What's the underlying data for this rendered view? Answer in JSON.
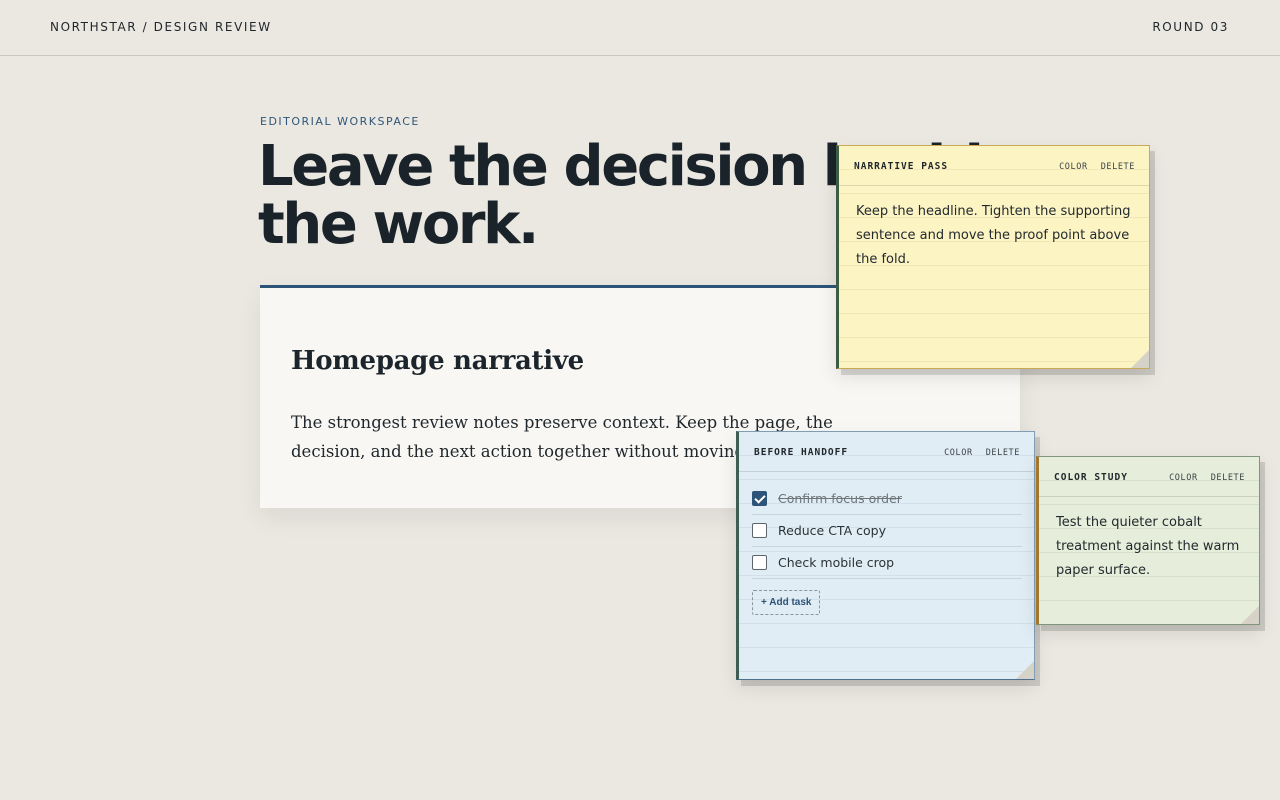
{
  "header": {
    "brand": "NORTHSTAR / DESIGN REVIEW",
    "round": "ROUND 03"
  },
  "hero": {
    "eyebrow": "EDITORIAL WORKSPACE",
    "headline": "Leave the decision beside the work."
  },
  "card": {
    "title": "Homepage narrative",
    "body": "The strongest review notes preserve context. Keep the page, the decision, and the next action together without moving the source"
  },
  "notes": [
    {
      "title": "NARRATIVE PASS",
      "color_label": "COLOR",
      "delete_label": "DELETE",
      "text": "Keep the headline. Tighten the supporting sentence and move the proof point above the fold.",
      "background": "#fdf4c3"
    },
    {
      "title": "BEFORE HANDOFF",
      "color_label": "COLOR",
      "delete_label": "DELETE",
      "tasks": [
        {
          "label": "Confirm focus order",
          "done": true
        },
        {
          "label": "Reduce CTA copy",
          "done": false
        },
        {
          "label": "Check mobile crop",
          "done": false
        }
      ],
      "add_task_label": "+ Add task",
      "background": "#e1edf4"
    },
    {
      "title": "COLOR STUDY",
      "color_label": "COLOR",
      "delete_label": "DELETE",
      "text": "Test the quieter cobalt treatment against the warm paper surface.",
      "background": "#e6edda"
    }
  ],
  "colors": {
    "accent": "#2e5378",
    "page": "#ebe8e1",
    "card": "#f8f7f3"
  }
}
